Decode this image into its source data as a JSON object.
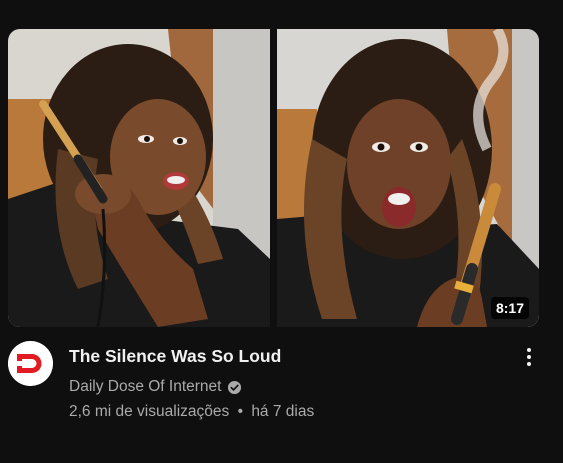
{
  "video": {
    "title": "The Silence Was So Loud",
    "duration": "8:17",
    "channel": "Daily Dose Of Internet",
    "views": "2,6 mi de visualizações",
    "separator": "•",
    "age": "há 7 dias",
    "verified": true
  },
  "icons": {
    "avatar": "daily-dose-logo",
    "verified": "verified-check-icon",
    "menu": "more-vert-icon"
  },
  "colors": {
    "background": "#0f0f0f",
    "title": "#f1f1f1",
    "secondary_text": "#aaaaaa",
    "logo_red": "#e21b23"
  }
}
